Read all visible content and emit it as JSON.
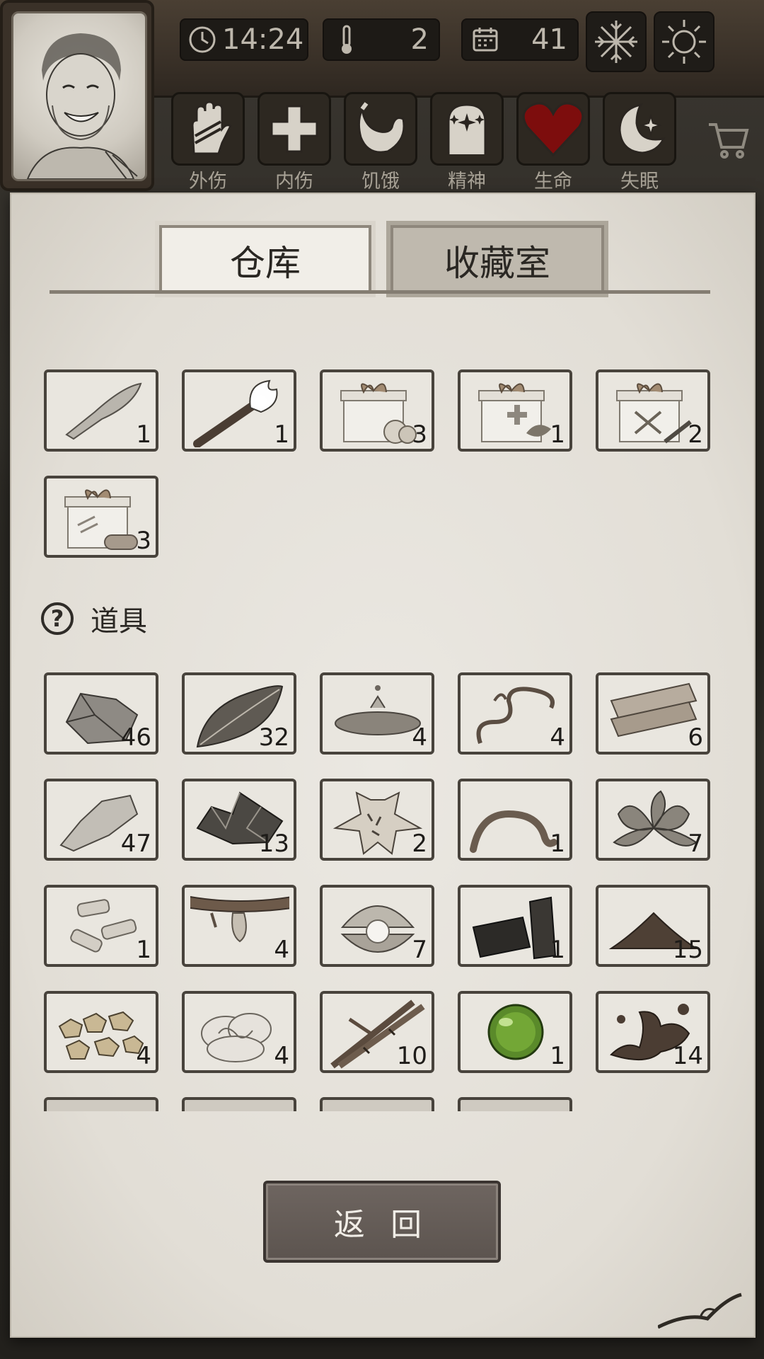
{
  "header": {
    "time": "14:24",
    "temperature": "2",
    "day": "41",
    "weather_icons": [
      "snowflake-icon",
      "sun-icon"
    ]
  },
  "status_bar": [
    {
      "label": "外伤",
      "icon": "hand-bandage-icon"
    },
    {
      "label": "内伤",
      "icon": "cross-icon"
    },
    {
      "label": "饥饿",
      "icon": "stomach-icon"
    },
    {
      "label": "精神",
      "icon": "head-sparkle-icon"
    },
    {
      "label": "生命",
      "icon": "heart-icon"
    },
    {
      "label": "失眠",
      "icon": "moon-star-icon"
    }
  ],
  "tabs": {
    "warehouse": "仓库",
    "collection": "收藏室"
  },
  "equipment": [
    {
      "icon": "stone-knife-icon",
      "qty": "1"
    },
    {
      "icon": "torch-icon",
      "qty": "1"
    },
    {
      "icon": "food-gift-box-icon",
      "qty": "3"
    },
    {
      "icon": "medical-gift-box-icon",
      "qty": "1"
    },
    {
      "icon": "weapon-gift-box-icon",
      "qty": "2"
    },
    {
      "icon": "material-gift-box-icon",
      "qty": "3"
    }
  ],
  "section": {
    "title": "道具",
    "help_icon": "question-icon"
  },
  "items": [
    {
      "icon": "rock-icon",
      "qty": "46"
    },
    {
      "icon": "leaf-icon",
      "qty": "32"
    },
    {
      "icon": "water-puddle-icon",
      "qty": "4"
    },
    {
      "icon": "vine-icon",
      "qty": "4"
    },
    {
      "icon": "planks-icon",
      "qty": "6"
    },
    {
      "icon": "flint-icon",
      "qty": "47"
    },
    {
      "icon": "ore-icon",
      "qty": "13"
    },
    {
      "icon": "animal-hide-icon",
      "qty": "2"
    },
    {
      "icon": "rope-icon",
      "qty": "1"
    },
    {
      "icon": "herb-icon",
      "qty": "7"
    },
    {
      "icon": "bone-icon",
      "qty": "1"
    },
    {
      "icon": "resin-icon",
      "qty": "4"
    },
    {
      "icon": "pearl-icon",
      "qty": "7"
    },
    {
      "icon": "charcoal-icon",
      "qty": "1"
    },
    {
      "icon": "soil-icon",
      "qty": "15"
    },
    {
      "icon": "gold-nugget-icon",
      "qty": "4"
    },
    {
      "icon": "cotton-icon",
      "qty": "4"
    },
    {
      "icon": "bamboo-icon",
      "qty": "10"
    },
    {
      "icon": "green-orb-icon",
      "qty": "1"
    },
    {
      "icon": "mud-icon",
      "qty": "14"
    }
  ],
  "back_button": "返 回"
}
